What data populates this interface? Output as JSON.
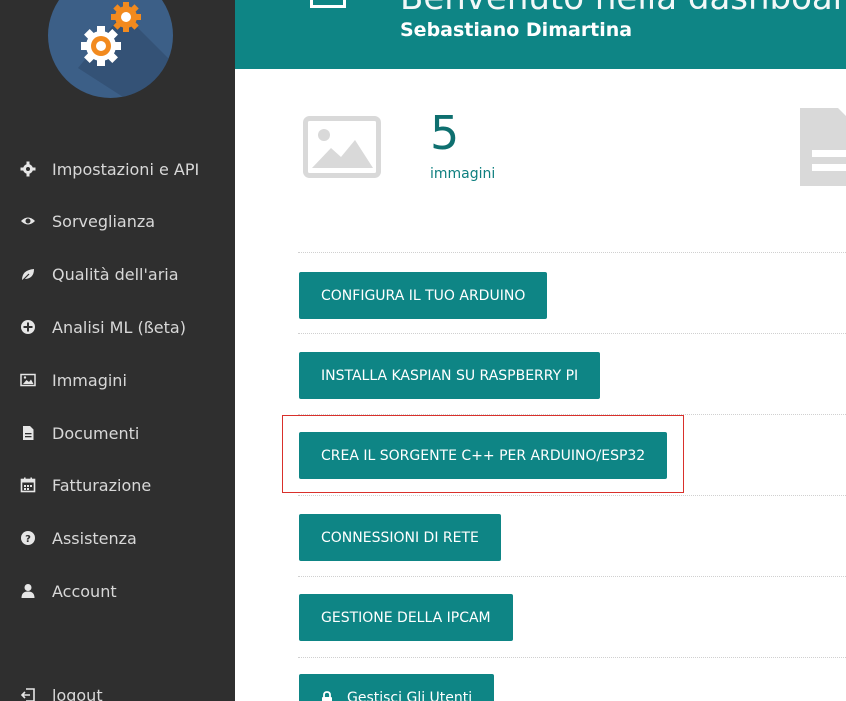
{
  "sidebar": {
    "items": [
      {
        "label": "Impostazioni e API",
        "icon": "gear-icon"
      },
      {
        "label": "Sorveglianza",
        "icon": "eye-icon"
      },
      {
        "label": "Qualità dell'aria",
        "icon": "leaf-icon"
      },
      {
        "label": "Analisi ML (ßeta)",
        "icon": "plus-circle-icon"
      },
      {
        "label": "Immagini",
        "icon": "image-icon"
      },
      {
        "label": "Documenti",
        "icon": "document-icon"
      },
      {
        "label": "Fatturazione",
        "icon": "calendar-icon"
      },
      {
        "label": "Assistenza",
        "icon": "question-circle-icon"
      },
      {
        "label": "Account",
        "icon": "user-icon"
      }
    ],
    "logout": {
      "label": "logout",
      "icon": "sign-out-icon"
    }
  },
  "header": {
    "title": "Benvenuto nella dashboard",
    "user": "Sebastiano Dimartina"
  },
  "stats": {
    "images": {
      "count": "5",
      "label": "immagini"
    }
  },
  "buttons": [
    {
      "label": "CONFIGURA IL TUO ARDUINO"
    },
    {
      "label": "INSTALLA KASPIAN SU RASPBERRY PI"
    },
    {
      "label": "CREA IL SORGENTE C++ PER ARDUINO/ESP32"
    },
    {
      "label": "CONNESSIONI DI RETE"
    },
    {
      "label": "GESTIONE DELLA IPCAM"
    },
    {
      "label": "Gestisci Gli Utenti"
    }
  ],
  "colors": {
    "sidebar_bg": "#2f2f2f",
    "accent": "#0e8585",
    "logo_bg": "#3c5f87",
    "gear_orange": "#f28a1e",
    "highlight": "#d9302b"
  }
}
